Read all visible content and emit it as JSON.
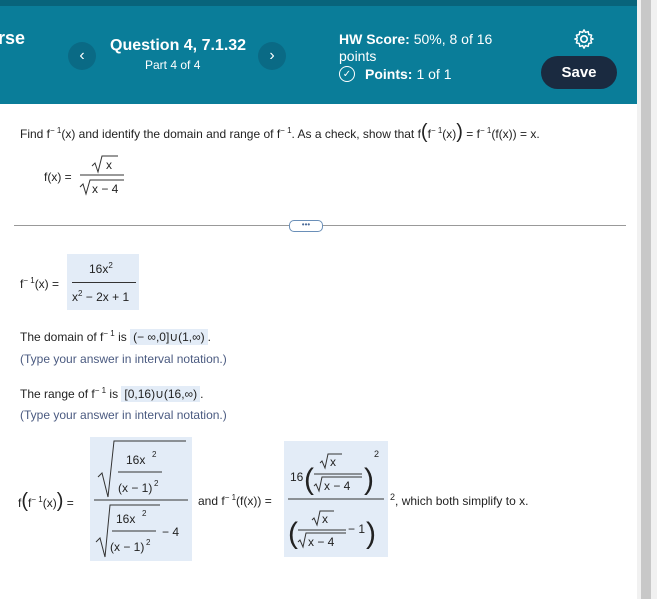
{
  "header": {
    "course_fragment": "rse",
    "prev_icon": "chevron-left",
    "next_icon": "chevron-right",
    "question_title": "Question 4, 7.1.32",
    "question_part": "Part 4 of 4",
    "hw_score_label": "HW Score:",
    "hw_score_value": "50%, 8 of 16",
    "hw_points_word": "points",
    "points_label": "Points:",
    "points_value": "1 of 1",
    "settings_icon": "gear",
    "save_label": "Save",
    "check_icon": "check-circle"
  },
  "problem": {
    "p1": "Find f",
    "p2": "(x) and identify the domain and range of f",
    "p3": ". As a check, show that f",
    "p4": "(x)",
    "p5": "= f",
    "p6": "(f(x)) = x.",
    "minus_one": "− 1",
    "given_lhs": "f(x) =",
    "sqrt_x": "x",
    "sqrt_x_minus_4": "x − 4"
  },
  "divider_icon": "ellipsis",
  "answer": {
    "finv_lhs_f": "f",
    "finv_lhs_rest": "(x) =",
    "finv_num": "16x",
    "finv_den": "x",
    "finv_den_rest": " − 2x + 1",
    "exp2": "2",
    "domain_prefix": "The domain of f",
    "domain_is": " is ",
    "domain_value": "(− ∞,0]∪(1,∞)",
    "domain_hint": "(Type your answer in interval notation.)",
    "range_prefix": "The range of f",
    "range_is": " is ",
    "range_value": "[0,16)∪(16,∞)",
    "range_hint": "(Type your answer in interval notation.)",
    "check_lhs": "f",
    "check_x_paren": "(x)",
    "check_num_top": "16x",
    "check_num_bottom": "(x − 1)",
    "minus_4": "− 4",
    "and_text": "and f",
    "fx_eq": "(f(x)) =",
    "sixteen": "16",
    "minus_1": "− 1",
    "both_simplify": "which both simplify to x.",
    "comma": ","
  }
}
